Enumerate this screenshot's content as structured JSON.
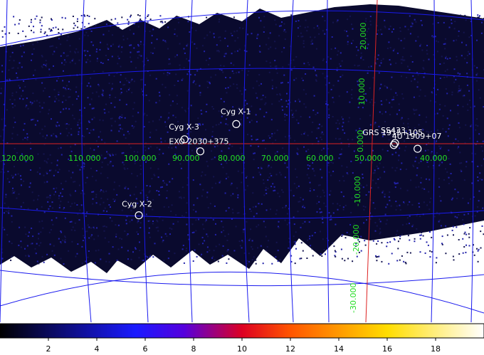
{
  "image": {
    "background_color": "#ffffff",
    "map_color": "#0a0a2e",
    "grid_color": "#1a1aee",
    "meridian_color": "#dd2222",
    "label_color": "#22dd22"
  },
  "longitude_labels": [
    "120.000",
    "110.000",
    "100.000",
    "90.000",
    "80.000",
    "70.000",
    "60.000",
    "50.000",
    "40.000"
  ],
  "latitude_labels": [
    "20.000",
    "10.000",
    "0.000",
    "-10.000",
    "-20.000",
    "-30.000"
  ],
  "sources": [
    {
      "name": "Cyg X-1",
      "glon": 71.3,
      "glat": 3.1
    },
    {
      "name": "Cyg X-3",
      "glon": 79.8,
      "glat": 0.7
    },
    {
      "name": "EXO 2030+375",
      "glon": 77.2,
      "glat": -1.2
    },
    {
      "name": "Cyg X-2",
      "glon": 87.3,
      "glat": -11.3
    },
    {
      "name": "GRS 1915+105",
      "glon": 45.4,
      "glat": -0.2
    },
    {
      "name": "4U 1909+07",
      "glon": 41.5,
      "glat": -0.8
    },
    {
      "name": "SS433",
      "glon": 45.2,
      "glat": 0.1
    }
  ],
  "colorbar": {
    "ticks": [
      "2",
      "4",
      "6",
      "8",
      "10",
      "12",
      "14",
      "16",
      "18"
    ]
  }
}
